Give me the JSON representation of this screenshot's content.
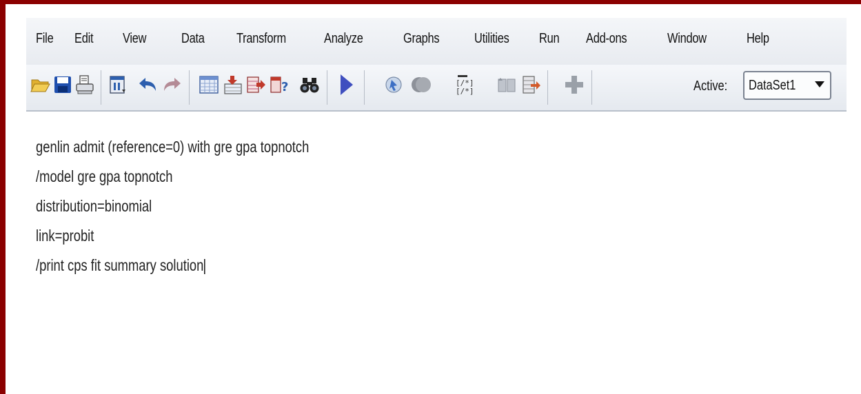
{
  "menu": {
    "items": [
      "File",
      "Edit",
      "View",
      "Data",
      "Transform",
      "Analyze",
      "Graphs",
      "Utilities",
      "Run",
      "Add-ons",
      "Window",
      "Help"
    ]
  },
  "toolbar": {
    "icons": [
      "open-folder-icon",
      "save-icon",
      "print-icon",
      "dialog-recall-icon",
      "undo-icon",
      "redo-icon",
      "data-editor-icon",
      "goto-case-icon",
      "goto-variable-icon",
      "variables-icon",
      "find-icon",
      "run-selection-icon",
      "bookmark-icon",
      "next-bookmark-icon",
      "comment-icon",
      "split-file-icon",
      "select-cases-icon",
      "extension-icon"
    ],
    "active_label": "Active:",
    "dataset_value": "DataSet1"
  },
  "colors": {
    "frame": "#8b0000",
    "run_arrow": "#3f4fbf",
    "save_blue": "#1f4fae"
  },
  "editor": {
    "lines": [
      "genlin admit (reference=0) with gre gpa topnotch",
      "/model gre gpa topnotch",
      "distribution=binomial",
      "link=probit",
      "/print cps fit summary solution"
    ]
  }
}
